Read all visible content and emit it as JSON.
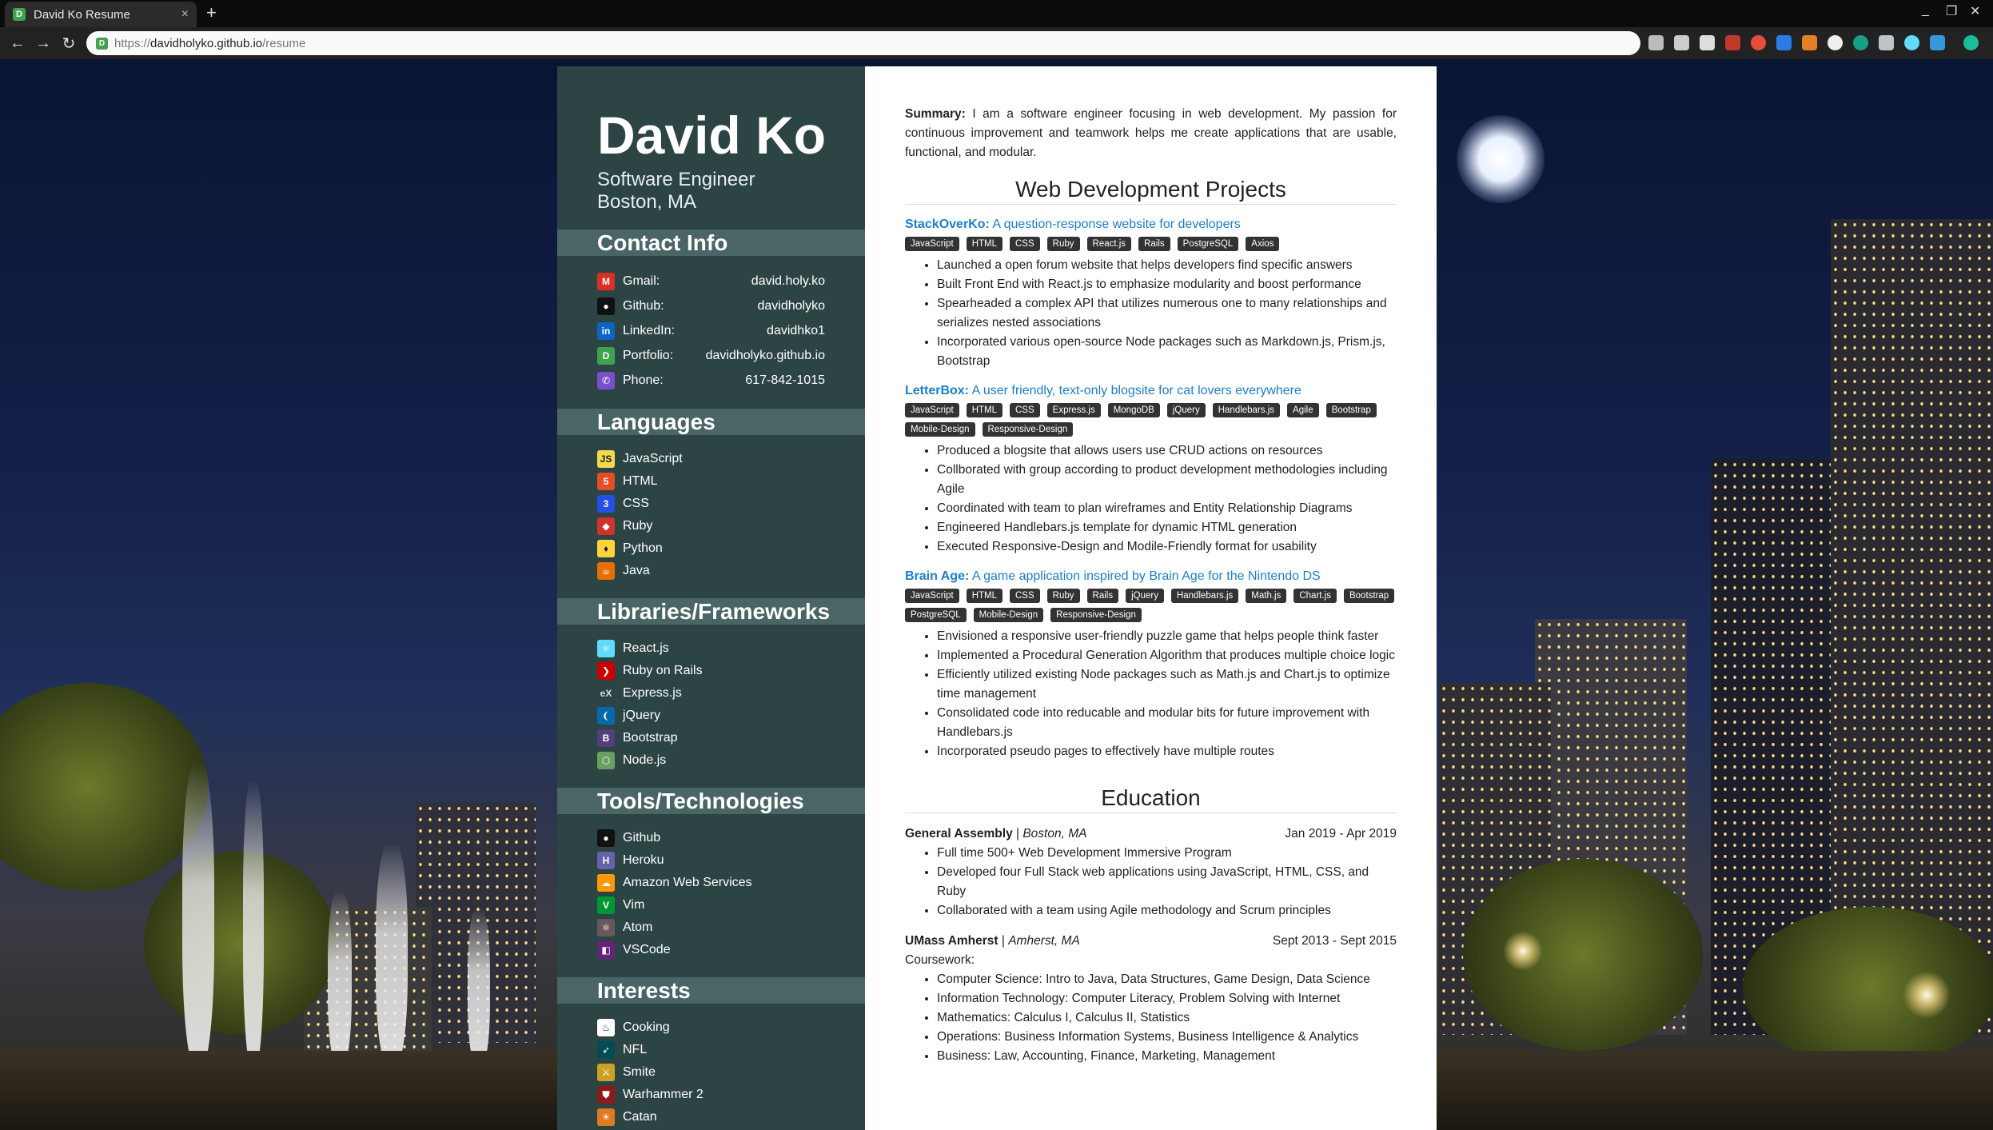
{
  "browser": {
    "tab_title": "David Ko Resume",
    "favicon_letter": "D",
    "url_scheme": "https://",
    "url_host": "davidholyko.github.io",
    "url_path": "/resume",
    "close_glyph": "×",
    "new_tab_glyph": "+",
    "minimize_glyph": "_",
    "restore_glyph": "❐",
    "close_window_glyph": "✕",
    "back_glyph": "←",
    "forward_glyph": "→",
    "reload_glyph": "↻",
    "menu_glyph": "⋮"
  },
  "sidebar": {
    "name": "David Ko",
    "title": "Software Engineer",
    "location": "Boston, MA",
    "contact_heading": "Contact Info",
    "contacts": [
      {
        "icon": "gmail-icon",
        "label": "Gmail:",
        "value": "david.holy.ko",
        "color": "#d93025"
      },
      {
        "icon": "github-icon",
        "label": "Github:",
        "value": "davidholyko",
        "color": "#111111"
      },
      {
        "icon": "linkedin-icon",
        "label": "LinkedIn:",
        "value": "davidhko1",
        "color": "#0a66c2"
      },
      {
        "icon": "portfolio-icon",
        "label": "Portfolio:",
        "value": "davidholyko.github.io",
        "color": "#3fa34d"
      },
      {
        "icon": "phone-icon",
        "label": "Phone:",
        "value": "617-842-1015",
        "color": "#7b4fc9"
      }
    ],
    "languages_heading": "Languages",
    "languages": [
      {
        "icon": "javascript-icon",
        "label": "JavaScript",
        "color": "#f0db4f"
      },
      {
        "icon": "html-icon",
        "label": "HTML",
        "color": "#e44d26"
      },
      {
        "icon": "css-icon",
        "label": "CSS",
        "color": "#264de4"
      },
      {
        "icon": "ruby-icon",
        "label": "Ruby",
        "color": "#cc342d"
      },
      {
        "icon": "python-icon",
        "label": "Python",
        "color": "#ffd43b"
      },
      {
        "icon": "java-icon",
        "label": "Java",
        "color": "#e76f00"
      }
    ],
    "frameworks_heading": "Libraries/Frameworks",
    "frameworks": [
      {
        "icon": "react-icon",
        "label": "React.js",
        "color": "#61dafb"
      },
      {
        "icon": "rails-icon",
        "label": "Ruby on Rails",
        "color": "#cc0000"
      },
      {
        "icon": "express-icon",
        "label": "Express.js",
        "color": "#cccccc"
      },
      {
        "icon": "jquery-icon",
        "label": "jQuery",
        "color": "#0769ad"
      },
      {
        "icon": "bootstrap-icon",
        "label": "Bootstrap",
        "color": "#563d7c"
      },
      {
        "icon": "nodejs-icon",
        "label": "Node.js",
        "color": "#68a063"
      }
    ],
    "tools_heading": "Tools/Technologies",
    "tools": [
      {
        "icon": "github-icon",
        "label": "Github",
        "color": "#111111"
      },
      {
        "icon": "heroku-icon",
        "label": "Heroku",
        "color": "#6762a6"
      },
      {
        "icon": "aws-icon",
        "label": "Amazon Web Services",
        "color": "#ff9900"
      },
      {
        "icon": "vim-icon",
        "label": "Vim",
        "color": "#019733"
      },
      {
        "icon": "atom-icon",
        "label": "Atom",
        "color": "#66595c"
      },
      {
        "icon": "vscode-icon",
        "label": "VSCode",
        "color": "#68217a"
      }
    ],
    "interests_heading": "Interests",
    "interests": [
      {
        "icon": "chef-hat-icon",
        "label": "Cooking",
        "color": "#ffffff"
      },
      {
        "icon": "nfl-eagles-icon",
        "label": "NFL",
        "color": "#004c54"
      },
      {
        "icon": "smite-icon",
        "label": "Smite",
        "color": "#c9a227"
      },
      {
        "icon": "warhammer-icon",
        "label": "Warhammer 2",
        "color": "#8b1a1a"
      },
      {
        "icon": "catan-icon",
        "label": "Catan",
        "color": "#e07a1f"
      }
    ]
  },
  "main": {
    "summary_label": "Summary:",
    "summary_text": " I am a software engineer focusing in web development. My passion for continuous improvement and teamwork helps me create applications that are usable, functional, and modular.",
    "projects_heading": "Web Development Projects",
    "projects": [
      {
        "name": "StackOverKo:",
        "desc": " A question-response website for developers",
        "tags": [
          "JavaScript",
          "HTML",
          "CSS",
          "Ruby",
          "React.js",
          "Rails",
          "PostgreSQL",
          "Axios"
        ],
        "bullets": [
          "Launched a open forum website that helps developers find specific answers",
          "Built Front End with React.js to emphasize modularity and boost performance",
          "Spearheaded a complex API that utilizes numerous one to many relationships and serializes nested associations",
          "Incorporated various open-source Node packages such as Markdown.js, Prism.js, Bootstrap"
        ]
      },
      {
        "name": "LetterBox:",
        "desc": " A user friendly, text-only blogsite for cat lovers everywhere",
        "tags": [
          "JavaScript",
          "HTML",
          "CSS",
          "Express.js",
          "MongoDB",
          "jQuery",
          "Handlebars.js",
          "Agile",
          "Bootstrap",
          "Mobile-Design",
          "Responsive-Design"
        ],
        "bullets": [
          "Produced a blogsite that allows users use CRUD actions on resources",
          "Collborated with group according to product development methodologies including Agile",
          "Coordinated with team to plan wireframes and Entity Relationship Diagrams",
          "Engineered Handlebars.js template for dynamic HTML generation",
          "Executed Responsive-Design and Modile-Friendly format for usability"
        ]
      },
      {
        "name": "Brain Age:",
        "desc": " A game application inspired by Brain Age for the Nintendo DS",
        "tags": [
          "JavaScript",
          "HTML",
          "CSS",
          "Ruby",
          "Rails",
          "jQuery",
          "Handlebars.js",
          "Math.js",
          "Chart.js",
          "Bootstrap",
          "PostgreSQL",
          "Mobile-Design",
          "Responsive-Design"
        ],
        "bullets": [
          "Envisioned a responsive user-friendly puzzle game that helps people think faster",
          "Implemented a Procedural Generation Algorithm that produces multiple choice logic",
          "Efficiently utilized existing Node packages such as Math.js and Chart.js to optimize time management",
          "Consolidated code into reducable and modular bits for future improvement with Handlebars.js",
          "Incorporated pseudo pages to effectively have multiple routes"
        ]
      }
    ],
    "education_heading": "Education",
    "education": [
      {
        "school": "General Assembly",
        "sep": " | ",
        "place": "Boston, MA",
        "dates": "Jan 2019 - Apr 2019",
        "intro": "",
        "bullets": [
          "Full time 500+ Web Development Immersive Program",
          "Developed four Full Stack web applications using JavaScript, HTML, CSS, and Ruby",
          "Collaborated with a team using Agile methodology and Scrum principles"
        ]
      },
      {
        "school": "UMass Amherst",
        "sep": " | ",
        "place": "Amherst, MA",
        "dates": "Sept 2013 - Sept 2015",
        "intro": "Coursework:",
        "bullets": [
          "Computer Science: Intro to Java, Data Structures, Game Design, Data Science",
          "Information Technology: Computer Literacy, Problem Solving with Internet",
          "Mathematics: Calculus I, Calculus II, Statistics",
          "Operations: Business Information Systems, Business Intelligence & Analytics",
          "Business: Law, Accounting, Finance, Marketing, Management"
        ]
      }
    ]
  }
}
